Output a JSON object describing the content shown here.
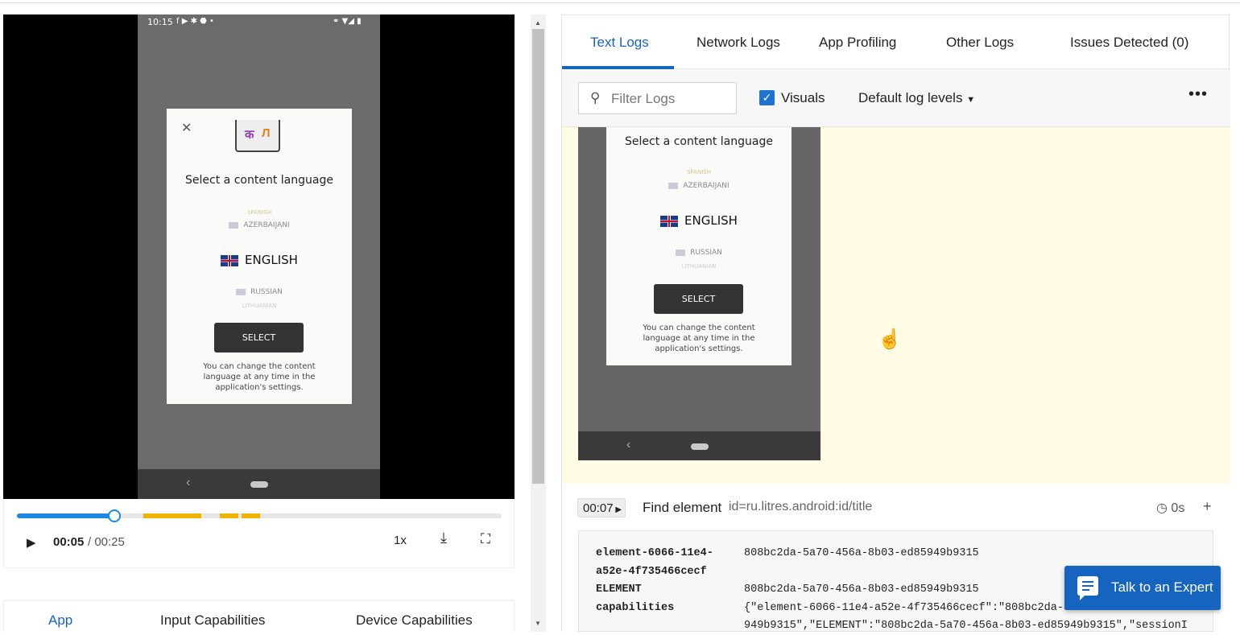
{
  "phone": {
    "status_time": "10:15",
    "dialog_title": "Select a content language",
    "languages_above": [
      "SPANISH",
      "AZERBAIJANI"
    ],
    "selected_language": "ENGLISH",
    "languages_below": [
      "RUSSIAN",
      "LITHUANIAN"
    ],
    "select_label": "SELECT",
    "note": "You can change the content language at any time in the application's settings.",
    "book_glyphs": [
      "क",
      "Л"
    ]
  },
  "player": {
    "current_time": "00:05",
    "total_time": "/ 00:25",
    "speed": "1x",
    "progress": 0.2
  },
  "left_tabs": [
    "App",
    "Input Capabilities",
    "Device Capabilities"
  ],
  "right_tabs": [
    "Text Logs",
    "Network Logs",
    "App Profiling",
    "Other Logs",
    "Issues Detected (0)"
  ],
  "toolbar": {
    "filter_placeholder": "Filter Logs",
    "visuals_label": "Visuals",
    "visuals_checked": true,
    "levels_label": "Default log levels"
  },
  "log_entry": {
    "timestamp": "00:07",
    "command": "Find element",
    "argument": "id=ru.litres.android:id/title",
    "duration": "0s",
    "rows": [
      {
        "key": "element-6066-11e4-",
        "value": "808bc2da-5a70-456a-8b03-ed85949b9315"
      },
      {
        "key": "a52e-4f735466cecf",
        "value": ""
      },
      {
        "key": "ELEMENT",
        "value": "808bc2da-5a70-456a-8b03-ed85949b9315"
      },
      {
        "key": "capabilities",
        "value": "{\"element-6066-11e4-a52e-4f735466cecf\":\"808bc2da-5a70-456a-8b03-ed85"
      },
      {
        "key": "",
        "value": "949b9315\",\"ELEMENT\":\"808bc2da-5a70-456a-8b03-ed85949b9315\",\"sessionI"
      }
    ]
  },
  "chat_label": "Talk to an Expert",
  "colors": {
    "accent": "#1565c0",
    "marker": "#f0b400",
    "visual_bg": "#fffbe5"
  }
}
